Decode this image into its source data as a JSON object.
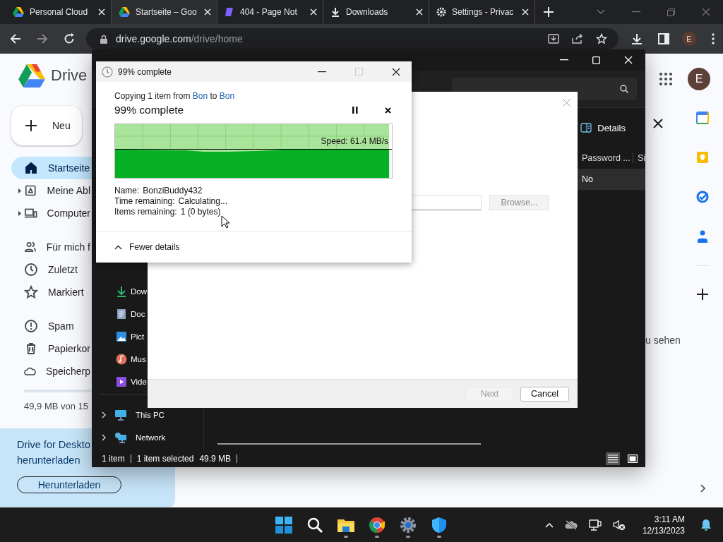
{
  "browser": {
    "tabs": [
      {
        "title": "Personal Cloud",
        "kind": "drive",
        "selected": false
      },
      {
        "title": "Startseite – Goo",
        "kind": "drive",
        "selected": true
      },
      {
        "title": "404 - Page Not",
        "kind": "page",
        "selected": false
      },
      {
        "title": "Downloads",
        "kind": "download",
        "selected": false
      },
      {
        "title": "Settings - Privac",
        "kind": "settings",
        "selected": false
      }
    ],
    "address": {
      "host": "drive.google.com",
      "path": "/drive/home"
    },
    "profile": "E"
  },
  "drive": {
    "logo": "Drive",
    "new_button": "Neu",
    "nav_groups": [
      [
        {
          "label": "Startseite",
          "kind": "home",
          "selected": true,
          "expandable": false
        },
        {
          "label": "Meine Abl",
          "kind": "drive",
          "selected": false,
          "expandable": true
        },
        {
          "label": "Computer",
          "kind": "computer",
          "selected": false,
          "expandable": true
        }
      ],
      [
        {
          "label": "Für mich f",
          "kind": "people",
          "selected": false,
          "expandable": false
        },
        {
          "label": "Zuletzt",
          "kind": "clock",
          "selected": false,
          "expandable": false
        },
        {
          "label": "Markiert",
          "kind": "star",
          "selected": false,
          "expandable": false
        }
      ],
      [
        {
          "label": "Spam",
          "kind": "spam",
          "selected": false,
          "expandable": false
        },
        {
          "label": "Papierkor",
          "kind": "trash",
          "selected": false,
          "expandable": false
        },
        {
          "label": "Speicherp",
          "kind": "cloud",
          "selected": false,
          "expandable": false
        }
      ]
    ],
    "storage": "49,9 MB von 15",
    "promo": {
      "line_1": "Drive for Deskto",
      "line_2": "herunterladen",
      "button": "Herunterladen"
    },
    "hint": "u sehen",
    "avatar": "E"
  },
  "explorer": {
    "details_button": "Details",
    "columns": [
      "Password ...",
      "Si"
    ],
    "rows": [
      {
        "cells": [
          "No"
        ],
        "selected": true
      }
    ],
    "nav": [
      {
        "label": "Dow",
        "kind": "download"
      },
      {
        "label": "Doc",
        "kind": "document"
      },
      {
        "label": "Pict",
        "kind": "pictures"
      },
      {
        "label": "Mus",
        "kind": "music"
      },
      {
        "label": "Vide",
        "kind": "video"
      }
    ],
    "tree": [
      {
        "label": "This PC",
        "kind": "pc"
      },
      {
        "label": "Network",
        "kind": "network"
      }
    ],
    "status": [
      "1 item",
      "1 item selected",
      "49.9 MB"
    ],
    "views": [
      {
        "kind": "details",
        "selected": true
      },
      {
        "kind": "tiles",
        "selected": false
      }
    ]
  },
  "wizard": {
    "browse": "Browse...",
    "next": {
      "label": "Next",
      "disabled": true
    },
    "cancel": "Cancel"
  },
  "copy": {
    "title": "99% complete",
    "prefix": "Copying 1 item from",
    "source": "Bon",
    "middle": "to",
    "dest": "Bon",
    "heading": "99% complete",
    "speed": "Speed: 61.4 MB/s",
    "progress": {
      "level": 0.99
    },
    "details": [
      {
        "label": "Name:",
        "value": "BonziBuddy432"
      },
      {
        "label": "Time remaining:",
        "value": "Calculating..."
      },
      {
        "label": "Items remaining:",
        "value": "1 (0 bytes)"
      }
    ],
    "toggle": "Fewer details"
  },
  "taskbar": {
    "apps": [
      {
        "kind": "start",
        "running": false
      },
      {
        "kind": "search",
        "running": false
      },
      {
        "kind": "files",
        "running": true
      },
      {
        "kind": "chrome",
        "running": true
      },
      {
        "kind": "settings",
        "running": true
      },
      {
        "kind": "defender",
        "running": true
      }
    ],
    "time": "3:11 AM",
    "date": "12/13/2023"
  }
}
